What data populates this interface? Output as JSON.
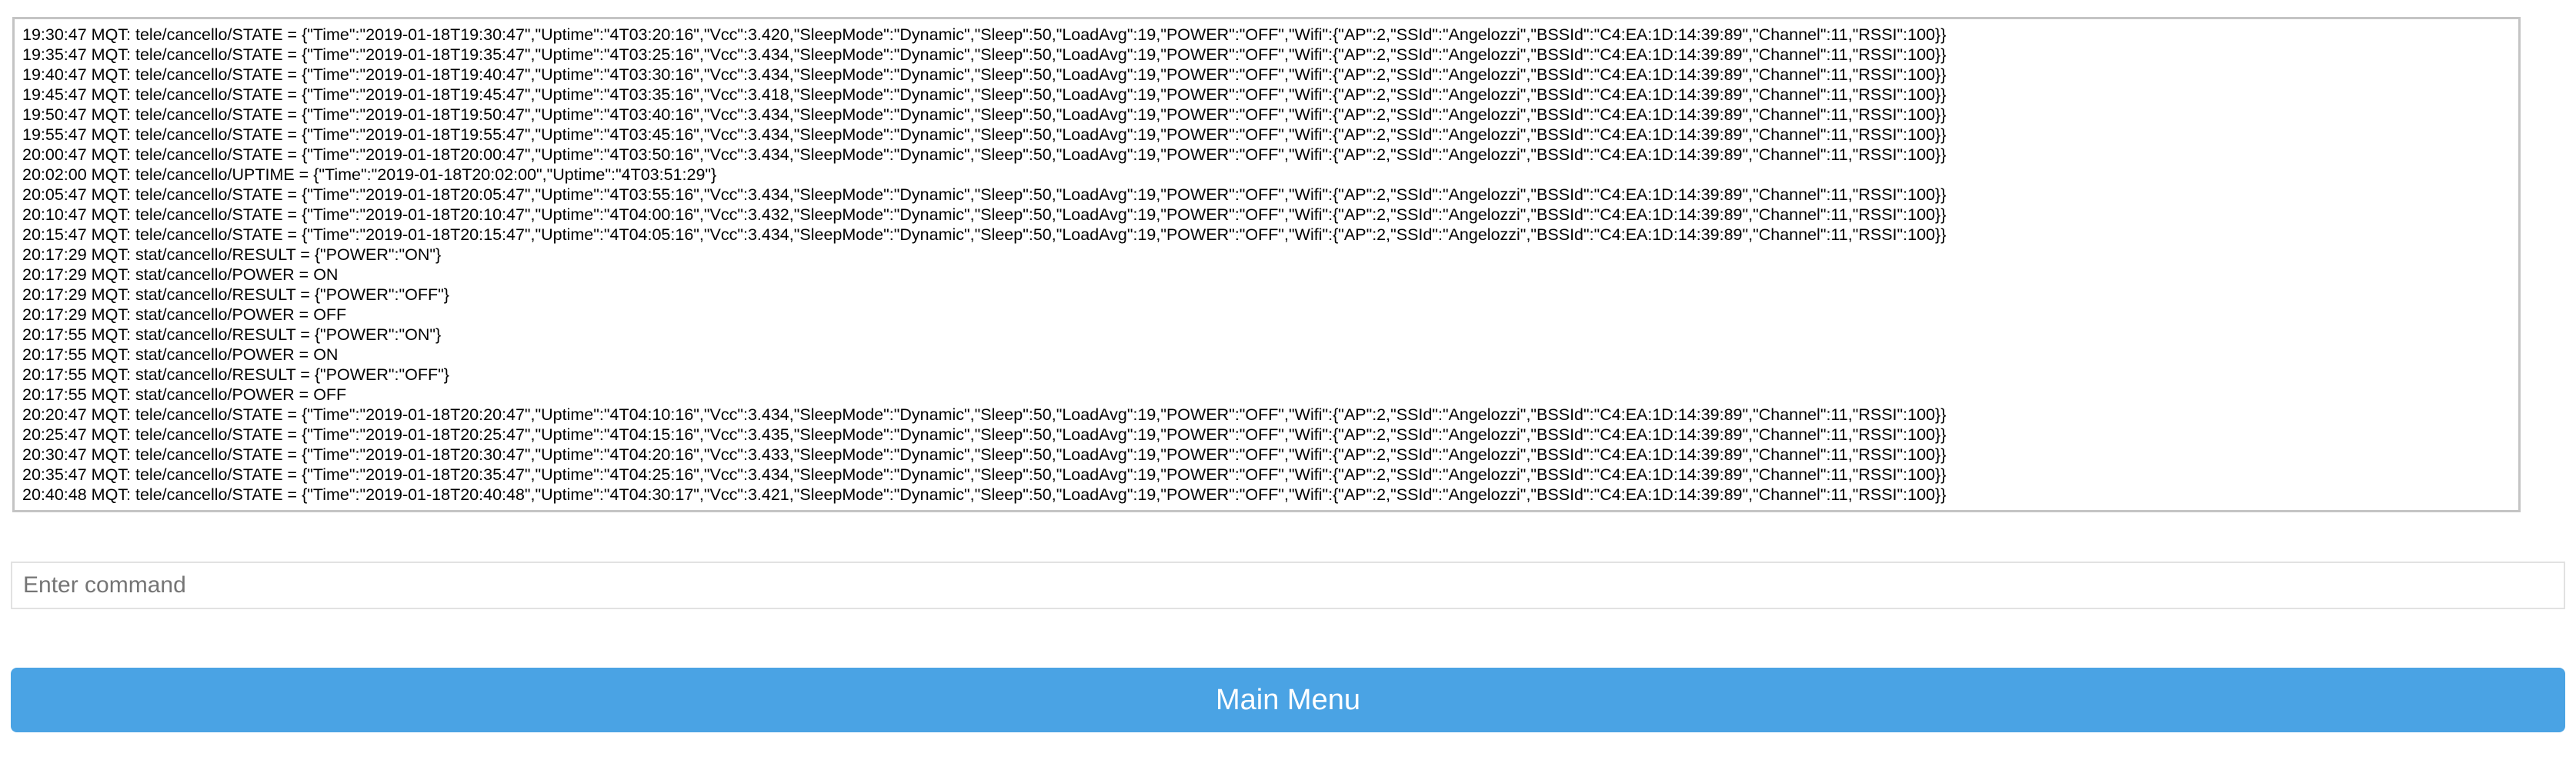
{
  "console": {
    "lines": [
      "19:30:47 MQT: tele/cancello/STATE = {\"Time\":\"2019-01-18T19:30:47\",\"Uptime\":\"4T03:20:16\",\"Vcc\":3.420,\"SleepMode\":\"Dynamic\",\"Sleep\":50,\"LoadAvg\":19,\"POWER\":\"OFF\",\"Wifi\":{\"AP\":2,\"SSId\":\"Angelozzi\",\"BSSId\":\"C4:EA:1D:14:39:89\",\"Channel\":11,\"RSSI\":100}}",
      "19:35:47 MQT: tele/cancello/STATE = {\"Time\":\"2019-01-18T19:35:47\",\"Uptime\":\"4T03:25:16\",\"Vcc\":3.434,\"SleepMode\":\"Dynamic\",\"Sleep\":50,\"LoadAvg\":19,\"POWER\":\"OFF\",\"Wifi\":{\"AP\":2,\"SSId\":\"Angelozzi\",\"BSSId\":\"C4:EA:1D:14:39:89\",\"Channel\":11,\"RSSI\":100}}",
      "19:40:47 MQT: tele/cancello/STATE = {\"Time\":\"2019-01-18T19:40:47\",\"Uptime\":\"4T03:30:16\",\"Vcc\":3.434,\"SleepMode\":\"Dynamic\",\"Sleep\":50,\"LoadAvg\":19,\"POWER\":\"OFF\",\"Wifi\":{\"AP\":2,\"SSId\":\"Angelozzi\",\"BSSId\":\"C4:EA:1D:14:39:89\",\"Channel\":11,\"RSSI\":100}}",
      "19:45:47 MQT: tele/cancello/STATE = {\"Time\":\"2019-01-18T19:45:47\",\"Uptime\":\"4T03:35:16\",\"Vcc\":3.418,\"SleepMode\":\"Dynamic\",\"Sleep\":50,\"LoadAvg\":19,\"POWER\":\"OFF\",\"Wifi\":{\"AP\":2,\"SSId\":\"Angelozzi\",\"BSSId\":\"C4:EA:1D:14:39:89\",\"Channel\":11,\"RSSI\":100}}",
      "19:50:47 MQT: tele/cancello/STATE = {\"Time\":\"2019-01-18T19:50:47\",\"Uptime\":\"4T03:40:16\",\"Vcc\":3.434,\"SleepMode\":\"Dynamic\",\"Sleep\":50,\"LoadAvg\":19,\"POWER\":\"OFF\",\"Wifi\":{\"AP\":2,\"SSId\":\"Angelozzi\",\"BSSId\":\"C4:EA:1D:14:39:89\",\"Channel\":11,\"RSSI\":100}}",
      "19:55:47 MQT: tele/cancello/STATE = {\"Time\":\"2019-01-18T19:55:47\",\"Uptime\":\"4T03:45:16\",\"Vcc\":3.434,\"SleepMode\":\"Dynamic\",\"Sleep\":50,\"LoadAvg\":19,\"POWER\":\"OFF\",\"Wifi\":{\"AP\":2,\"SSId\":\"Angelozzi\",\"BSSId\":\"C4:EA:1D:14:39:89\",\"Channel\":11,\"RSSI\":100}}",
      "20:00:47 MQT: tele/cancello/STATE = {\"Time\":\"2019-01-18T20:00:47\",\"Uptime\":\"4T03:50:16\",\"Vcc\":3.434,\"SleepMode\":\"Dynamic\",\"Sleep\":50,\"LoadAvg\":19,\"POWER\":\"OFF\",\"Wifi\":{\"AP\":2,\"SSId\":\"Angelozzi\",\"BSSId\":\"C4:EA:1D:14:39:89\",\"Channel\":11,\"RSSI\":100}}",
      "20:02:00 MQT: tele/cancello/UPTIME = {\"Time\":\"2019-01-18T20:02:00\",\"Uptime\":\"4T03:51:29\"}",
      "20:05:47 MQT: tele/cancello/STATE = {\"Time\":\"2019-01-18T20:05:47\",\"Uptime\":\"4T03:55:16\",\"Vcc\":3.434,\"SleepMode\":\"Dynamic\",\"Sleep\":50,\"LoadAvg\":19,\"POWER\":\"OFF\",\"Wifi\":{\"AP\":2,\"SSId\":\"Angelozzi\",\"BSSId\":\"C4:EA:1D:14:39:89\",\"Channel\":11,\"RSSI\":100}}",
      "20:10:47 MQT: tele/cancello/STATE = {\"Time\":\"2019-01-18T20:10:47\",\"Uptime\":\"4T04:00:16\",\"Vcc\":3.432,\"SleepMode\":\"Dynamic\",\"Sleep\":50,\"LoadAvg\":19,\"POWER\":\"OFF\",\"Wifi\":{\"AP\":2,\"SSId\":\"Angelozzi\",\"BSSId\":\"C4:EA:1D:14:39:89\",\"Channel\":11,\"RSSI\":100}}",
      "20:15:47 MQT: tele/cancello/STATE = {\"Time\":\"2019-01-18T20:15:47\",\"Uptime\":\"4T04:05:16\",\"Vcc\":3.434,\"SleepMode\":\"Dynamic\",\"Sleep\":50,\"LoadAvg\":19,\"POWER\":\"OFF\",\"Wifi\":{\"AP\":2,\"SSId\":\"Angelozzi\",\"BSSId\":\"C4:EA:1D:14:39:89\",\"Channel\":11,\"RSSI\":100}}",
      "20:17:29 MQT: stat/cancello/RESULT = {\"POWER\":\"ON\"}",
      "20:17:29 MQT: stat/cancello/POWER = ON",
      "20:17:29 MQT: stat/cancello/RESULT = {\"POWER\":\"OFF\"}",
      "20:17:29 MQT: stat/cancello/POWER = OFF",
      "20:17:55 MQT: stat/cancello/RESULT = {\"POWER\":\"ON\"}",
      "20:17:55 MQT: stat/cancello/POWER = ON",
      "20:17:55 MQT: stat/cancello/RESULT = {\"POWER\":\"OFF\"}",
      "20:17:55 MQT: stat/cancello/POWER = OFF",
      "20:20:47 MQT: tele/cancello/STATE = {\"Time\":\"2019-01-18T20:20:47\",\"Uptime\":\"4T04:10:16\",\"Vcc\":3.434,\"SleepMode\":\"Dynamic\",\"Sleep\":50,\"LoadAvg\":19,\"POWER\":\"OFF\",\"Wifi\":{\"AP\":2,\"SSId\":\"Angelozzi\",\"BSSId\":\"C4:EA:1D:14:39:89\",\"Channel\":11,\"RSSI\":100}}",
      "20:25:47 MQT: tele/cancello/STATE = {\"Time\":\"2019-01-18T20:25:47\",\"Uptime\":\"4T04:15:16\",\"Vcc\":3.435,\"SleepMode\":\"Dynamic\",\"Sleep\":50,\"LoadAvg\":19,\"POWER\":\"OFF\",\"Wifi\":{\"AP\":2,\"SSId\":\"Angelozzi\",\"BSSId\":\"C4:EA:1D:14:39:89\",\"Channel\":11,\"RSSI\":100}}",
      "20:30:47 MQT: tele/cancello/STATE = {\"Time\":\"2019-01-18T20:30:47\",\"Uptime\":\"4T04:20:16\",\"Vcc\":3.433,\"SleepMode\":\"Dynamic\",\"Sleep\":50,\"LoadAvg\":19,\"POWER\":\"OFF\",\"Wifi\":{\"AP\":2,\"SSId\":\"Angelozzi\",\"BSSId\":\"C4:EA:1D:14:39:89\",\"Channel\":11,\"RSSI\":100}}",
      "20:35:47 MQT: tele/cancello/STATE = {\"Time\":\"2019-01-18T20:35:47\",\"Uptime\":\"4T04:25:16\",\"Vcc\":3.434,\"SleepMode\":\"Dynamic\",\"Sleep\":50,\"LoadAvg\":19,\"POWER\":\"OFF\",\"Wifi\":{\"AP\":2,\"SSId\":\"Angelozzi\",\"BSSId\":\"C4:EA:1D:14:39:89\",\"Channel\":11,\"RSSI\":100}}",
      "20:40:48 MQT: tele/cancello/STATE = {\"Time\":\"2019-01-18T20:40:48\",\"Uptime\":\"4T04:30:17\",\"Vcc\":3.421,\"SleepMode\":\"Dynamic\",\"Sleep\":50,\"LoadAvg\":19,\"POWER\":\"OFF\",\"Wifi\":{\"AP\":2,\"SSId\":\"Angelozzi\",\"BSSId\":\"C4:EA:1D:14:39:89\",\"Channel\":11,\"RSSI\":100}}"
    ]
  },
  "command": {
    "placeholder": "Enter command",
    "value": ""
  },
  "main_menu": {
    "label": "Main Menu"
  },
  "colors": {
    "button_bg": "#4aa3e4",
    "button_text": "#ffffff",
    "console_border": "#c4c4c4"
  }
}
